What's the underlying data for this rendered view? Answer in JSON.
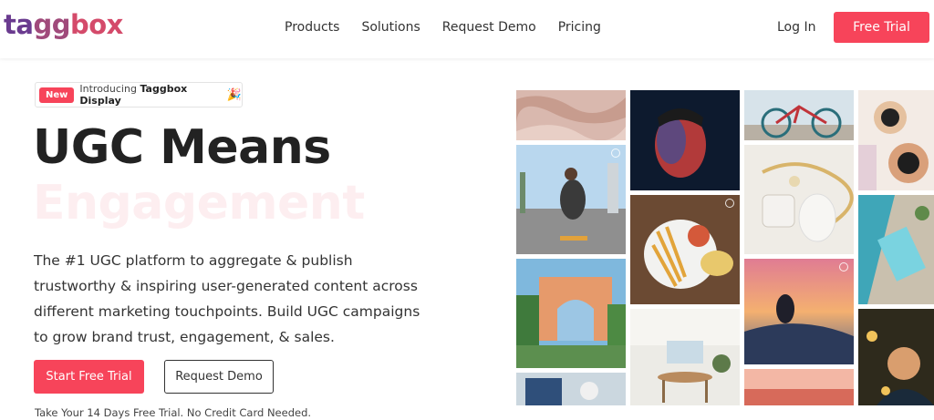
{
  "header": {
    "logo": {
      "part1": "ta",
      "part2": "gg",
      "part3": "box"
    },
    "nav": [
      "Products",
      "Solutions",
      "Request Demo",
      "Pricing"
    ],
    "login": "Log In",
    "free_trial": "Free Trial"
  },
  "hero": {
    "badge": {
      "new": "New",
      "intro_prefix": "Introducing ",
      "intro_bold": "Taggbox Display",
      "emoji": "🎉"
    },
    "headline_line1": "UGC Means",
    "headline_line2": "Engagement",
    "description": "The #1 UGC platform to aggregate & publish trustworthy & inspiring user-generated content across different marketing touchpoints. Build UGC campaigns to grow brand trust, engagement, & sales.",
    "cta_primary": "Start Free Trial",
    "cta_secondary": "Request Demo",
    "note": "Take Your 14 Days Free Trial. No Credit Card Needed."
  },
  "colors": {
    "accent": "#f7445a",
    "logo_purple": "#6a3b8f",
    "logo_pink": "#d44a6a",
    "text": "#333333"
  },
  "gallery": {
    "images": [
      "fabric-photo",
      "portrait-red-light-photo",
      "bicycle-photo",
      "makeup-photo",
      "skateboarder-city-photo",
      "jewelry-photo",
      "fries-food-photo",
      "aerial-pool-photo",
      "resort-building-photo",
      "skatepark-sunset-photo",
      "dining-room-photo",
      "child-photo",
      "drinks-table-photo",
      "sunset-sea-photo"
    ]
  }
}
